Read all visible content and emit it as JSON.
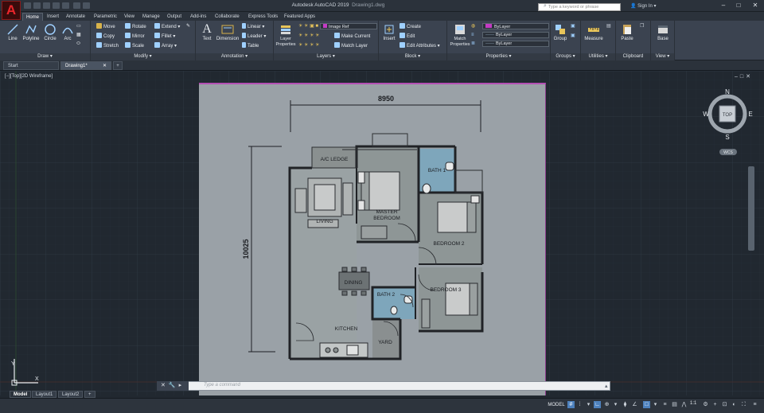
{
  "app": {
    "title": "Autodesk AutoCAD 2019",
    "doc": "Drawing1.dwg",
    "search_placeholder": "Type a keyword or phrase",
    "signin": "Sign In",
    "logo": "A"
  },
  "ribbon_tabs": [
    "Home",
    "Insert",
    "Annotate",
    "Parametric",
    "View",
    "Manage",
    "Output",
    "Add-ins",
    "Collaborate",
    "Express Tools",
    "Featured Apps"
  ],
  "panels": {
    "draw": {
      "label": "Draw ▾",
      "line": "Line",
      "polyline": "Polyline",
      "circle": "Circle",
      "arc": "Arc"
    },
    "modify": {
      "label": "Modify ▾",
      "move": "Move",
      "rotate": "Rotate",
      "extend": "Extend ▾",
      "copy": "Copy",
      "mirror": "Mirror",
      "fillet": "Fillet ▾",
      "stretch": "Stretch",
      "scale": "Scale",
      "array": "Array ▾"
    },
    "annotation": {
      "label": "Annotation ▾",
      "text": "Text",
      "dimension": "Dimension",
      "linear": "Linear ▾",
      "leader": "Leader ▾",
      "table": "Table"
    },
    "layers": {
      "label": "Layers ▾",
      "props": "Layer Properties",
      "current_layer": "Image Ref",
      "make_current": "Make Current",
      "match_layer": "Match Layer"
    },
    "block": {
      "label": "Block ▾",
      "insert": "Insert",
      "create": "Create",
      "edit": "Edit",
      "edit_attributes": "Edit Attributes ▾"
    },
    "properties": {
      "label": "Properties ▾",
      "match": "Match Properties",
      "color": "ByLayer",
      "linetype": "ByLayer",
      "lineweight": "ByLayer"
    },
    "groups": {
      "label": "Groups ▾",
      "group": "Group"
    },
    "utilities": {
      "label": "Utilities ▾",
      "measure": "Measure"
    },
    "clipboard": {
      "label": "Clipboard",
      "paste": "Paste"
    },
    "view": {
      "label": "View ▾",
      "base": "Base"
    }
  },
  "doc_tabs": [
    "Start",
    "Drawing1*"
  ],
  "viewport": {
    "label": "[−][Top][2D Wireframe]",
    "viewcube": {
      "top": "TOP",
      "n": "N",
      "s": "S",
      "e": "E",
      "w": "W",
      "wcs": "WCS"
    }
  },
  "plan": {
    "dim_width": "8950",
    "dim_height": "10025",
    "rooms": {
      "ac_ledge": "A/C LEDGE",
      "living": "LIVING",
      "master": "MASTER\nBEDROOM",
      "bath1": "BATH 1",
      "bedroom2": "BEDROOM 2",
      "dining": "DINING",
      "bath2": "BATH 2",
      "bedroom3": "BEDROOM 3",
      "kitchen": "KITCHEN",
      "yard": "YARD"
    }
  },
  "cmdline": {
    "placeholder": "Type a command"
  },
  "layout_tabs": [
    "Model",
    "Layout1",
    "Layout2"
  ],
  "status": {
    "model": "MODEL",
    "scale": "1:1"
  }
}
